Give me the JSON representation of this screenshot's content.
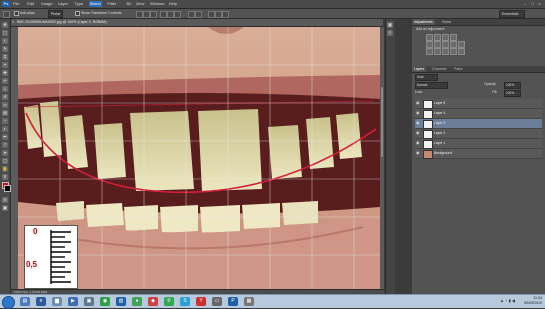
{
  "menubar": {
    "logo": "Ps",
    "items": [
      "File",
      "Edit",
      "Image",
      "Layer",
      "Type",
      "Select",
      "Filter",
      "3D",
      "View",
      "Window",
      "Help"
    ],
    "active_index": 5,
    "minimize": "–",
    "maximize": "□",
    "close": "×"
  },
  "options": {
    "mode_label": "Anti-alias",
    "style_label": "Pintar",
    "feather_label": "Show Transform Controls",
    "workspace": "Essentials"
  },
  "document": {
    "tab_title": "IMG-20190905-WA0002.jpg @ 100% (Layer 2, RGB/8#)",
    "status": "100%    Doc: 1,37M/5,89M"
  },
  "panels": {
    "top_tabs": [
      "Adjustments",
      "Styles"
    ],
    "add_adjustment_label": "Add an adjustment",
    "mid_tabs": [
      "Layers",
      "Channels",
      "Paths"
    ],
    "kind_label": "Kind",
    "blend_mode": "Normal",
    "opacity_label": "Opacity:",
    "opacity_value": "100%",
    "lock_label": "Lock:",
    "fill_label": "Fill:",
    "fill_value": "100%",
    "layers": [
      {
        "name": "Layer 5",
        "photo": false,
        "selected": false
      },
      {
        "name": "Layer 4",
        "photo": false,
        "selected": false
      },
      {
        "name": "Layer 3",
        "photo": false,
        "selected": true
      },
      {
        "name": "Layer 2",
        "photo": false,
        "selected": false
      },
      {
        "name": "Layer 1",
        "photo": false,
        "selected": false
      },
      {
        "name": "Background",
        "photo": true,
        "selected": false
      }
    ]
  },
  "scale": {
    "top": "0",
    "mid": "0,5"
  },
  "taskbar": {
    "time": "11:54",
    "date": "05/09/2019"
  },
  "colors": {
    "accent": "#2f6db6",
    "guide_line": "#d0203a",
    "foreground": "#d01020",
    "background": "#000000"
  }
}
